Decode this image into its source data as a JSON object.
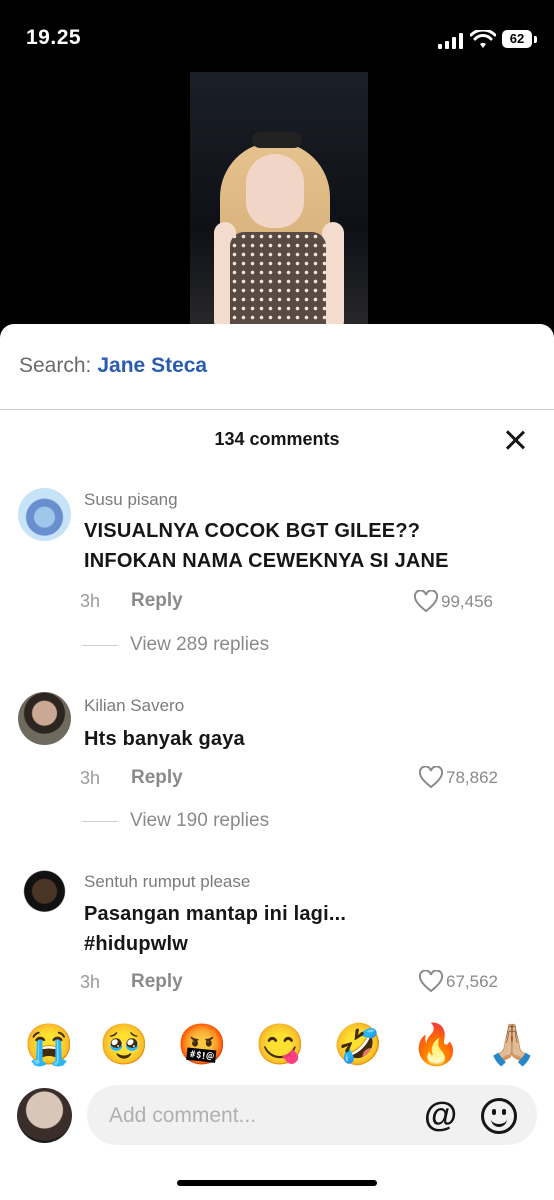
{
  "status": {
    "time": "19.25",
    "battery": "62"
  },
  "search": {
    "label": "Search:",
    "query": "Jane Steca"
  },
  "comments_header": {
    "count_text": "134 comments"
  },
  "comments": [
    {
      "user": "Susu pisang",
      "text_lines": [
        "VISUALNYA COCOK BGT GILEE??",
        "INFOKAN NAMA CEWEKNYA SI JANE"
      ],
      "time": "3h",
      "reply": "Reply",
      "likes": "99,456",
      "replies_text": "View 289 replies"
    },
    {
      "user": "Kilian Savero",
      "text_lines": [
        "Hts banyak gaya"
      ],
      "time": "3h",
      "reply": "Reply",
      "likes": "78,862",
      "replies_text": "View 190 replies"
    },
    {
      "user": "Sentuh rumput please",
      "text_lines": [
        "Pasangan mantap ini lagi...",
        "#hidupwlw"
      ],
      "time": "3h",
      "reply": "Reply",
      "likes": "67,562"
    }
  ],
  "quick_emojis": [
    "😭",
    "🥹",
    "🤬",
    "😋",
    "🤣",
    "🔥",
    "🙏🏼"
  ],
  "composer": {
    "placeholder": "Add comment...",
    "mention_icon": "@"
  }
}
